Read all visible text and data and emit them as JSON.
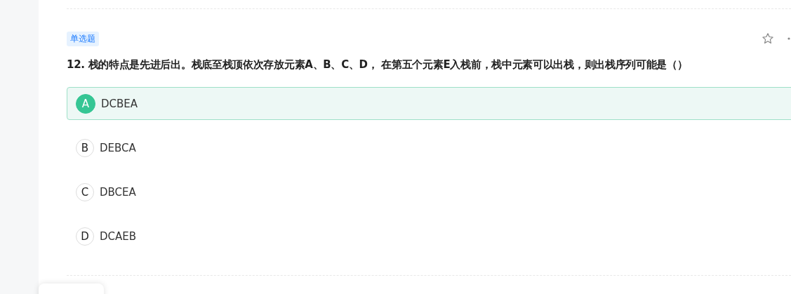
{
  "question": {
    "type_tag": "单选题",
    "text": "12. 栈的特点是先进后出。栈底至栈顶依次存放元素A、B、C、D，  在第五个元素E入栈前，栈中元素可以出栈，则出栈序列可能是（）",
    "options": [
      {
        "letter": "A",
        "text": "DCBEA",
        "selected": true
      },
      {
        "letter": "B",
        "text": "DEBCA",
        "selected": false
      },
      {
        "letter": "C",
        "text": "DBCEA",
        "selected": false
      },
      {
        "letter": "D",
        "text": "DCAEB",
        "selected": false
      }
    ]
  }
}
